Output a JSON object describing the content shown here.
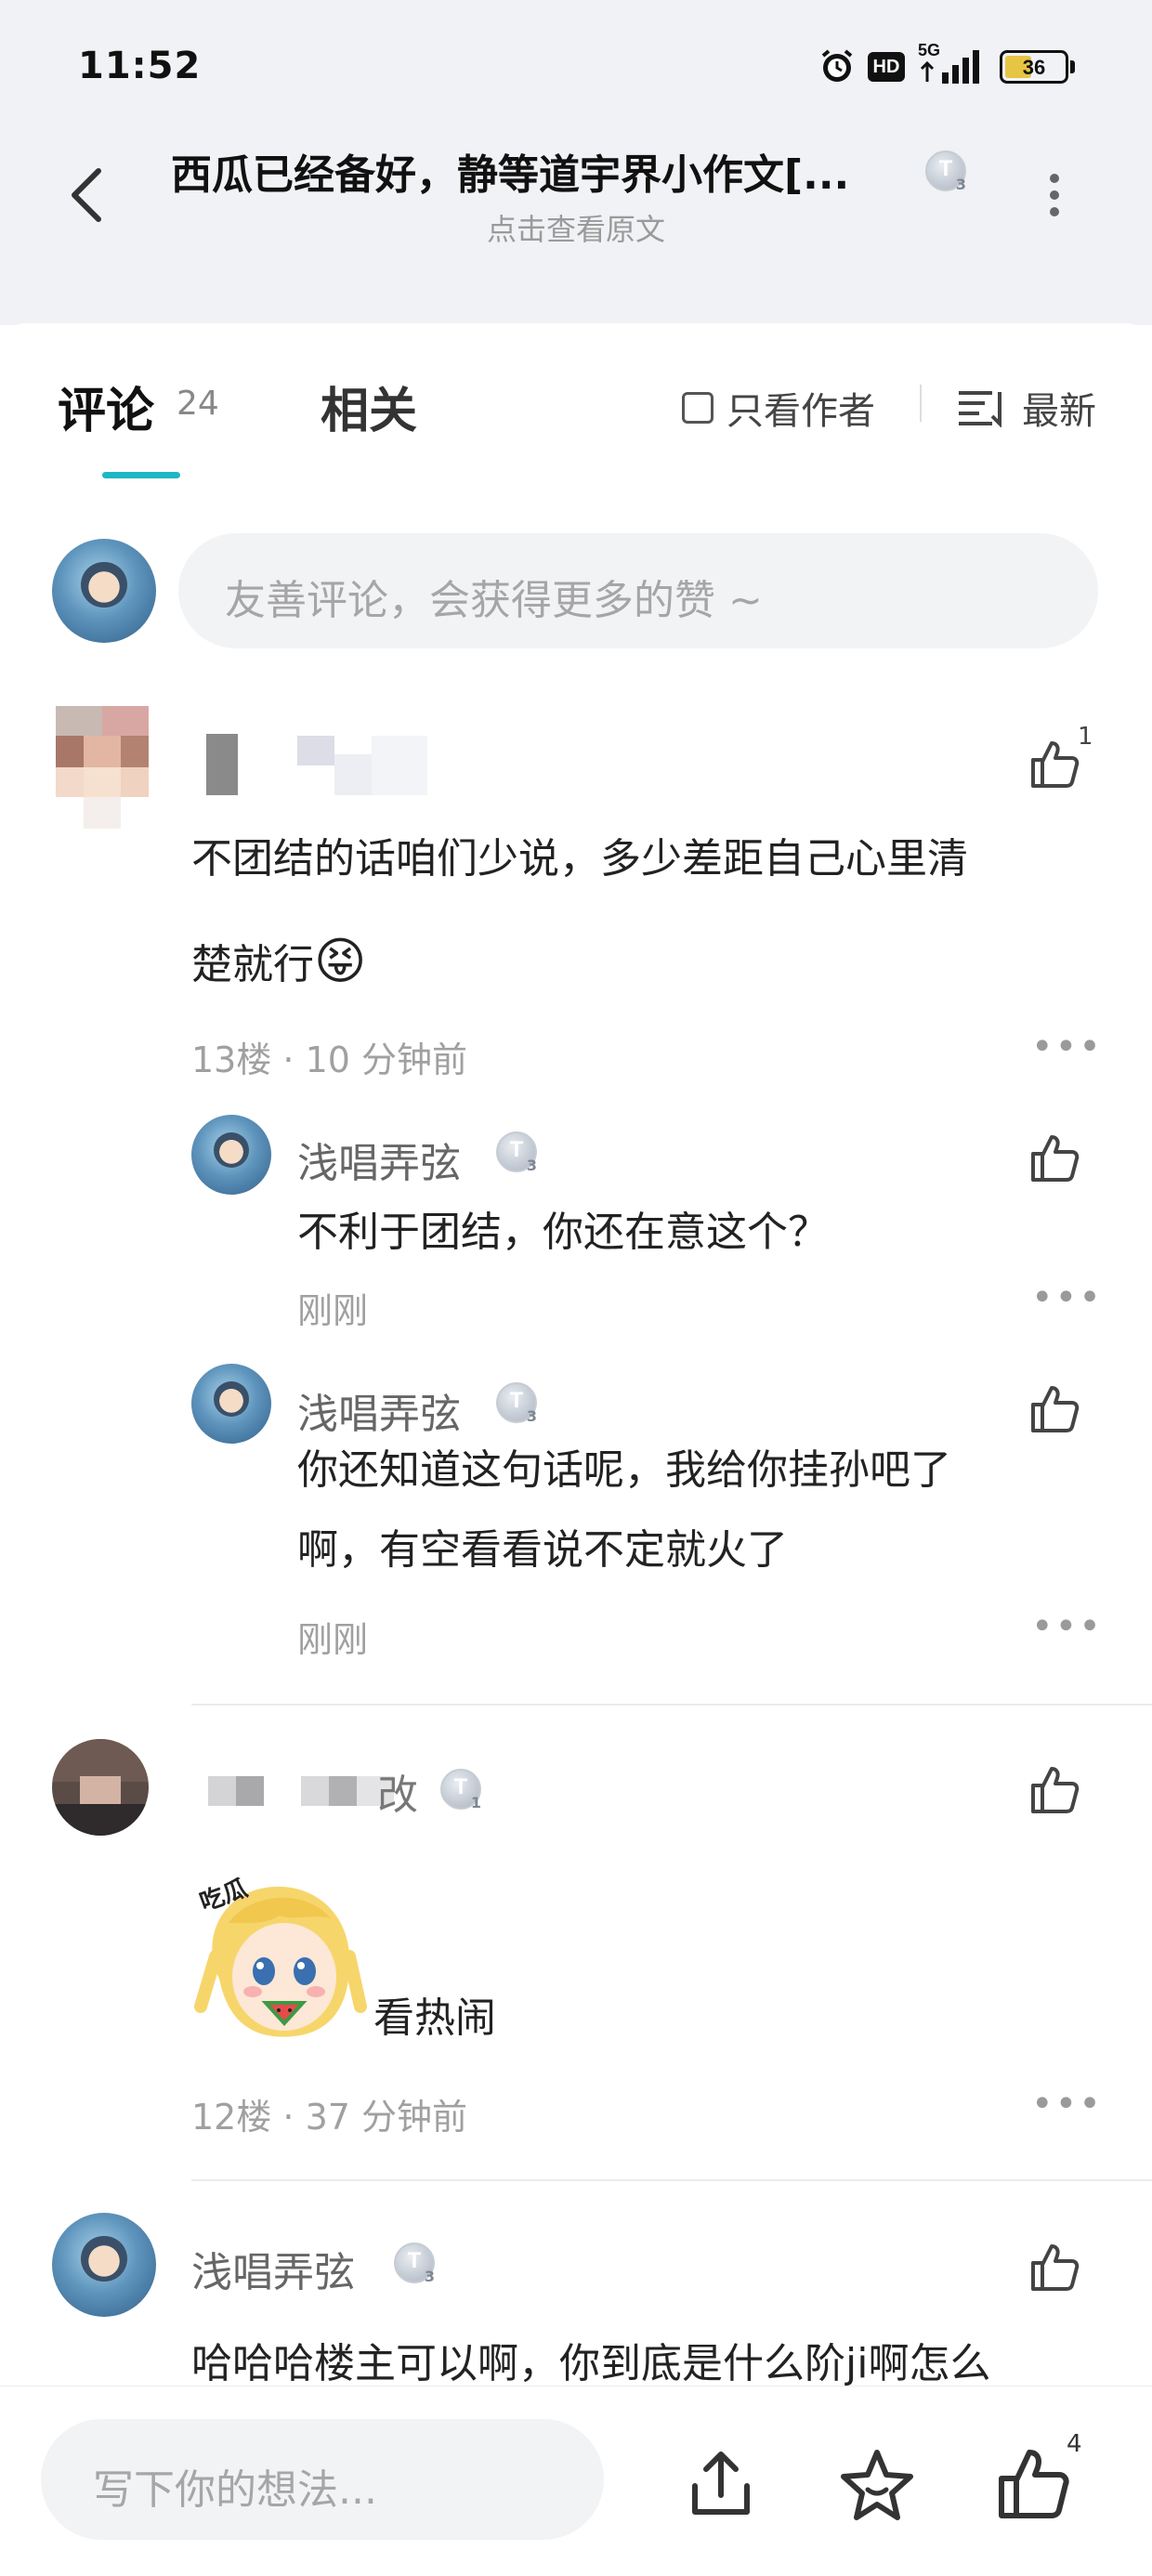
{
  "status_bar": {
    "time": "11:52",
    "network": "5G",
    "hd": "HD",
    "battery": "36"
  },
  "header": {
    "title": "西瓜已经备好，静等道宇界小作文[...",
    "subtitle": "点击查看原文",
    "author_level": {
      "letter": "T",
      "number": "3"
    }
  },
  "tabs": {
    "comments_label": "评论",
    "comments_count": "24",
    "related_label": "相关",
    "author_only_label": "只看作者",
    "sort_label": "最新"
  },
  "comment_input": {
    "placeholder": "友善评论，会获得更多的赞 ~"
  },
  "comments": [
    {
      "text_line1": "不团结的话咱们少说，多少差距自己心里清",
      "text_line2": "楚就行",
      "emoji": "😝",
      "likes": "1",
      "meta": "13楼 · 10 分钟前",
      "replies": [
        {
          "name": "浅唱弄弦",
          "level": {
            "letter": "T",
            "number": "3"
          },
          "text": "不利于团结，你还在意这个？",
          "time": "刚刚"
        },
        {
          "name": "浅唱弄弦",
          "level": {
            "letter": "T",
            "number": "3"
          },
          "text_line1": "你还知道这句话呢，我给你挂孙吧了",
          "text_line2": "啊，有空看看说不定就火了",
          "time": "刚刚"
        }
      ]
    },
    {
      "name_fragment": "改",
      "level": {
        "letter": "T",
        "number": "1"
      },
      "sticker_label": "吃瓜",
      "text": "看热闹",
      "meta": "12楼 · 37 分钟前"
    },
    {
      "name": "浅唱弄弦",
      "level": {
        "letter": "T",
        "number": "3"
      },
      "text": "哈哈哈楼主可以啊，你到底是什么阶ji啊怎么"
    }
  ],
  "bottom_bar": {
    "placeholder": "写下你的想法...",
    "like_count": "4"
  },
  "colors": {
    "accent": "#1fb7c4",
    "background_top": "#f1f2f5",
    "muted_text": "#a0a0a0"
  }
}
